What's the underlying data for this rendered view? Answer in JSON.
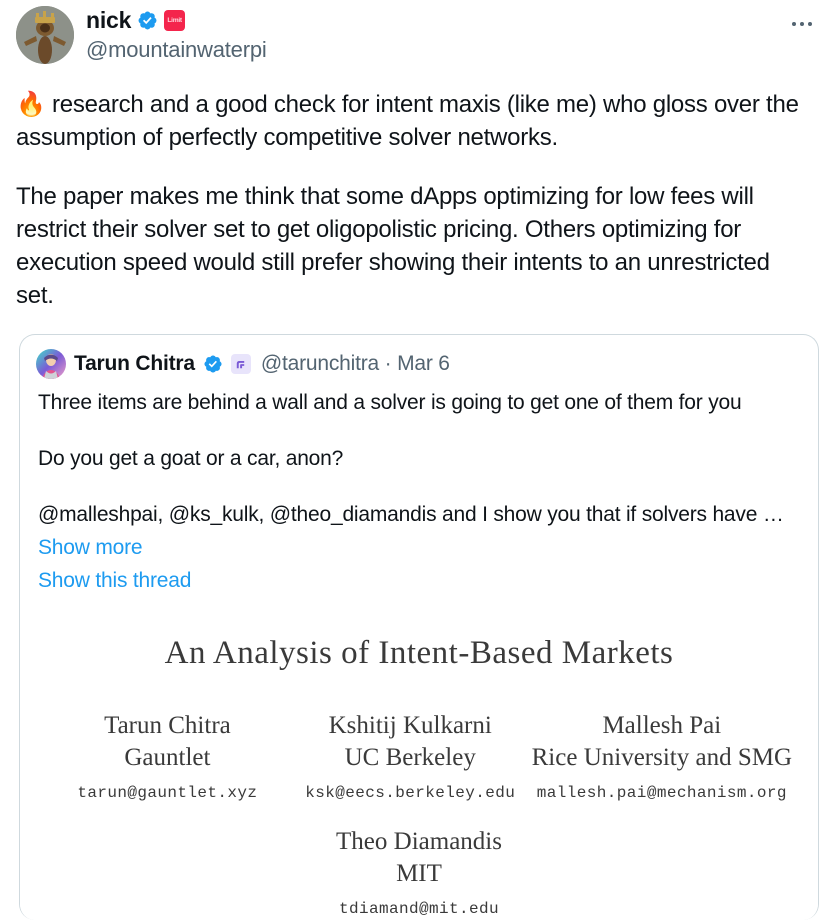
{
  "tweet": {
    "author": {
      "display_name": "nick",
      "handle": "@mountainwaterpi",
      "verified_badge": "verified-checkmark",
      "affiliate_badge_label": "Limit",
      "affiliate_badge_color": "#f4254c",
      "avatar_alt": "gold-figurine-avatar"
    },
    "more_button_label": "More",
    "body": {
      "paragraph_1": "🔥 research and a good check for intent maxis (like me) who gloss over the assumption of perfectly competitive solver networks.",
      "paragraph_2": "The paper makes me think that some dApps optimizing for low fees will restrict their solver set to get oligopolistic pricing. Others optimizing for execution speed would still prefer showing their intents to an unrestricted set."
    }
  },
  "quoted_tweet": {
    "author": {
      "display_name": "Tarun Chitra",
      "handle": "@tarunchitra",
      "verified_badge": "verified-checkmark",
      "affiliate_badge_name": "gauntlet-logo",
      "affiliate_badge_color": "#e8e4fb",
      "avatar_alt": "anime-portrait-avatar"
    },
    "separator": "·",
    "timestamp": "Mar 6",
    "body": {
      "paragraph_1": "Three items are behind a wall and a solver is going to get one of them for you",
      "paragraph_2": "Do you get a goat or a car, anon?",
      "paragraph_3": "@malleshpai, @ks_kulk, @theo_diamandis and I show you that if solvers have …"
    },
    "links": {
      "show_more": "Show more",
      "show_thread": "Show this thread"
    },
    "link_color": "#1d9bf0",
    "paper_preview": {
      "title": "An Analysis of Intent-Based Markets",
      "authors": [
        {
          "name": "Tarun Chitra",
          "affiliation": "Gauntlet",
          "email": "tarun@gauntlet.xyz"
        },
        {
          "name": "Kshitij Kulkarni",
          "affiliation": "UC Berkeley",
          "email": "ksk@eecs.berkeley.edu"
        },
        {
          "name": "Mallesh Pai",
          "affiliation": "Rice University and SMG",
          "email": "mallesh.pai@mechanism.org"
        }
      ],
      "authors_second_row": [
        {
          "name": "Theo Diamandis",
          "affiliation": "MIT",
          "email": "tdiamand@mit.edu"
        }
      ]
    }
  }
}
